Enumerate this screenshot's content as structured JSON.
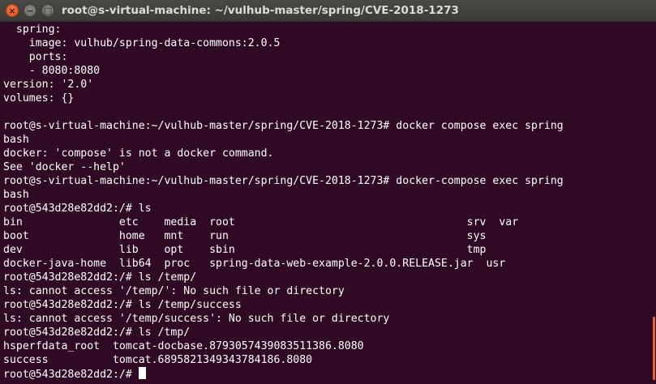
{
  "window": {
    "title": "root@s-virtual-machine: ~/vulhub-master/spring/CVE-2018-1273",
    "close_glyph": "×",
    "min_glyph": "−",
    "max_glyph": "□"
  },
  "terminal": {
    "lines": [
      "  spring:",
      "    image: vulhub/spring-data-commons:2.0.5",
      "    ports:",
      "    - 8080:8080",
      "version: '2.0'",
      "volumes: {}",
      "",
      "root@s-virtual-machine:~/vulhub-master/spring/CVE-2018-1273# docker compose exec spring",
      "bash",
      "docker: 'compose' is not a docker command.",
      "See 'docker --help'",
      "root@s-virtual-machine:~/vulhub-master/spring/CVE-2018-1273# docker-compose exec spring",
      "bash",
      "root@543d28e82dd2:/# ls",
      "bin               etc    media  root                                    srv  var",
      "boot              home   mnt    run                                     sys",
      "dev               lib    opt    sbin                                    tmp",
      "docker-java-home  lib64  proc   spring-data-web-example-2.0.0.RELEASE.jar  usr",
      "root@543d28e82dd2:/# ls /temp/",
      "ls: cannot access '/temp/': No such file or directory",
      "root@543d28e82dd2:/# ls /temp/success",
      "ls: cannot access '/temp/success': No such file or directory",
      "root@543d28e82dd2:/# ls /tmp/",
      "hsperfdata_root  tomcat-docbase.8793057439083511386.8080",
      "success          tomcat.6895821349343784186.8080"
    ],
    "prompt": "root@543d28e82dd2:/# "
  },
  "colors": {
    "background": "#300a24",
    "text": "#ffffff",
    "close_button": "#e1501c",
    "scroll_thumb": "#e9622a"
  }
}
